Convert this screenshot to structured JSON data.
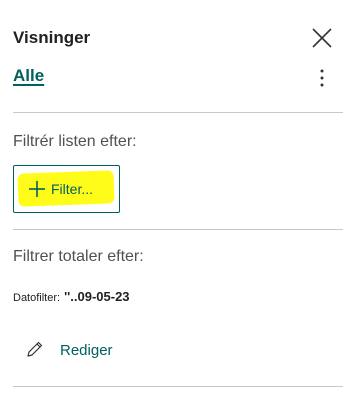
{
  "pane": {
    "title": "Visninger",
    "close_icon": "close-icon",
    "more_icon": "more-vertical-icon"
  },
  "views": {
    "current": "Alle"
  },
  "list_filter": {
    "heading": "Filtrér listen efter:",
    "button_label": "Filter...",
    "button_icon": "plus-icon",
    "highlight_color": "#fffc1a"
  },
  "totals_filter": {
    "heading": "Filtrer totaler efter:",
    "date_label": "Datofilter:",
    "date_value": "''..09-05-23"
  },
  "edit": {
    "label": "Rediger",
    "icon": "pencil-icon"
  },
  "colors": {
    "accent": "#00605f",
    "text": "#212121",
    "secondary_text": "#505050",
    "divider": "#c8c8c8"
  }
}
